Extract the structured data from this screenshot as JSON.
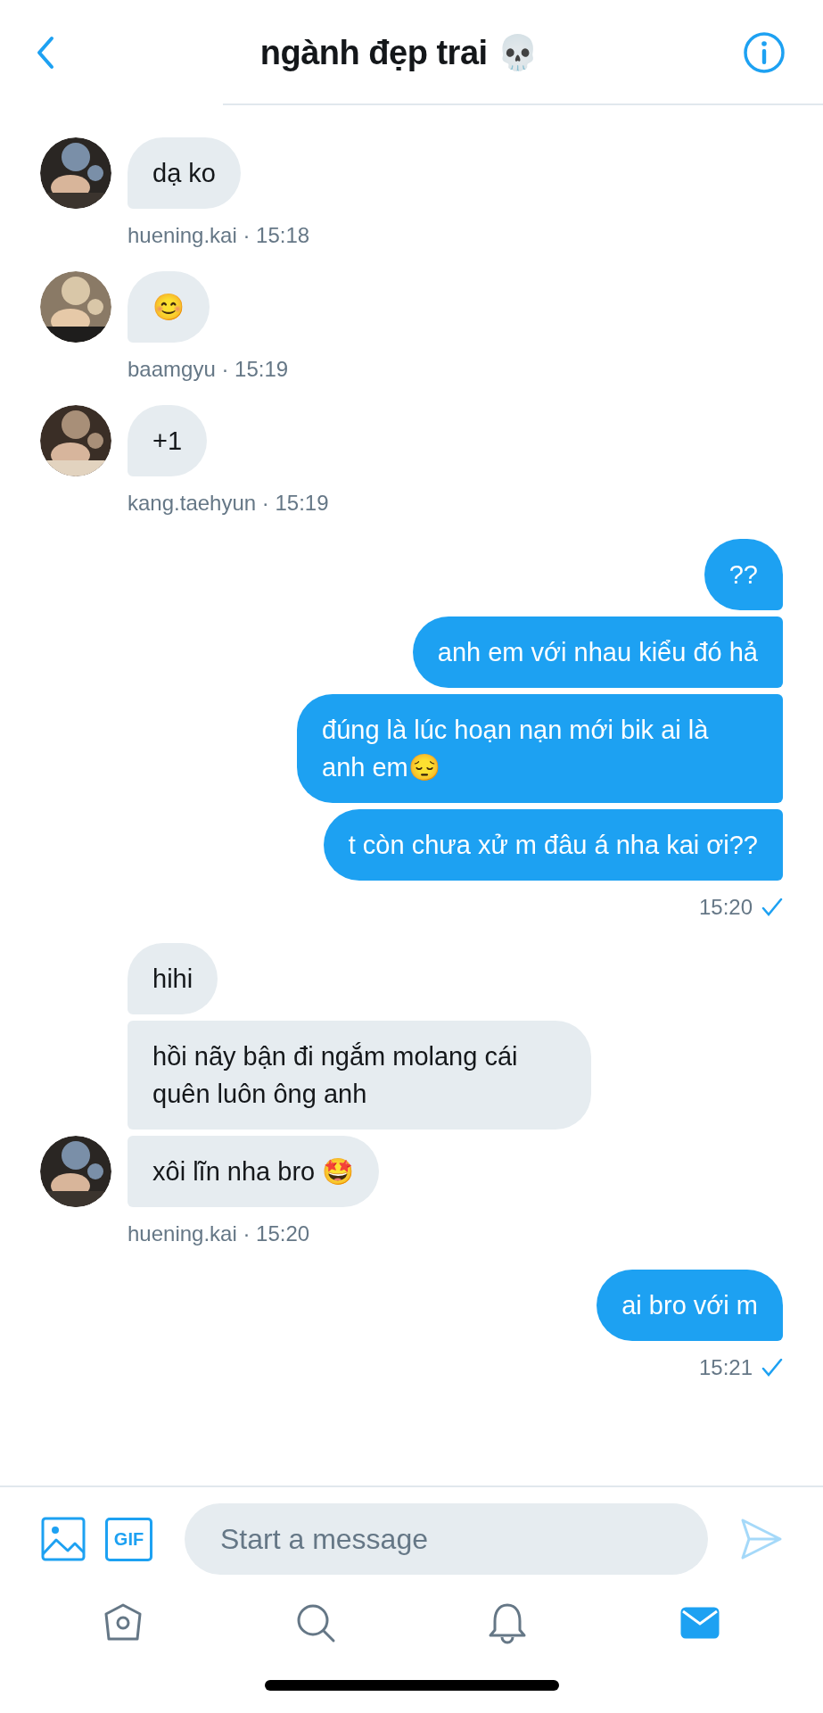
{
  "header": {
    "title": "ngành đẹp trai 💀"
  },
  "groups": [
    {
      "kind": "incoming",
      "avatar": {
        "kind": "picture"
      },
      "messages": [
        "dạ ko"
      ],
      "meta": "huening.kai · 15:18"
    },
    {
      "kind": "incoming",
      "avatar": {
        "kind": "picture"
      },
      "messages": [
        "😊"
      ],
      "meta": "baamgyu · 15:19"
    },
    {
      "kind": "incoming",
      "avatar": {
        "kind": "picture"
      },
      "messages": [
        "+1"
      ],
      "meta": "kang.taehyun · 15:19"
    },
    {
      "kind": "outgoing",
      "messages": [
        "??",
        "anh em với nhau kiểu đó hả",
        "đúng là lúc hoạn nạn mới bik ai là anh em😔",
        "t còn chưa xử m đâu á nha kai ơi??"
      ],
      "meta": "15:20",
      "read": true
    },
    {
      "kind": "incoming",
      "avatar": {
        "kind": "picture"
      },
      "messages": [
        "hihi",
        "hồi nãy bận đi ngắm molang cái quên luôn ông anh",
        "xôi lĩn nha bro 🤩"
      ],
      "meta": "huening.kai · 15:20"
    },
    {
      "kind": "outgoing",
      "messages": [
        "ai bro với m"
      ],
      "meta": "15:21",
      "read": true
    }
  ],
  "composer": {
    "placeholder": "Start a message",
    "gif_label": "GIF"
  },
  "tab_bar": [
    {
      "kind": "home",
      "selected": false
    },
    {
      "kind": "search",
      "selected": false
    },
    {
      "kind": "notifications",
      "selected": false
    },
    {
      "kind": "messages",
      "selected": true
    }
  ]
}
